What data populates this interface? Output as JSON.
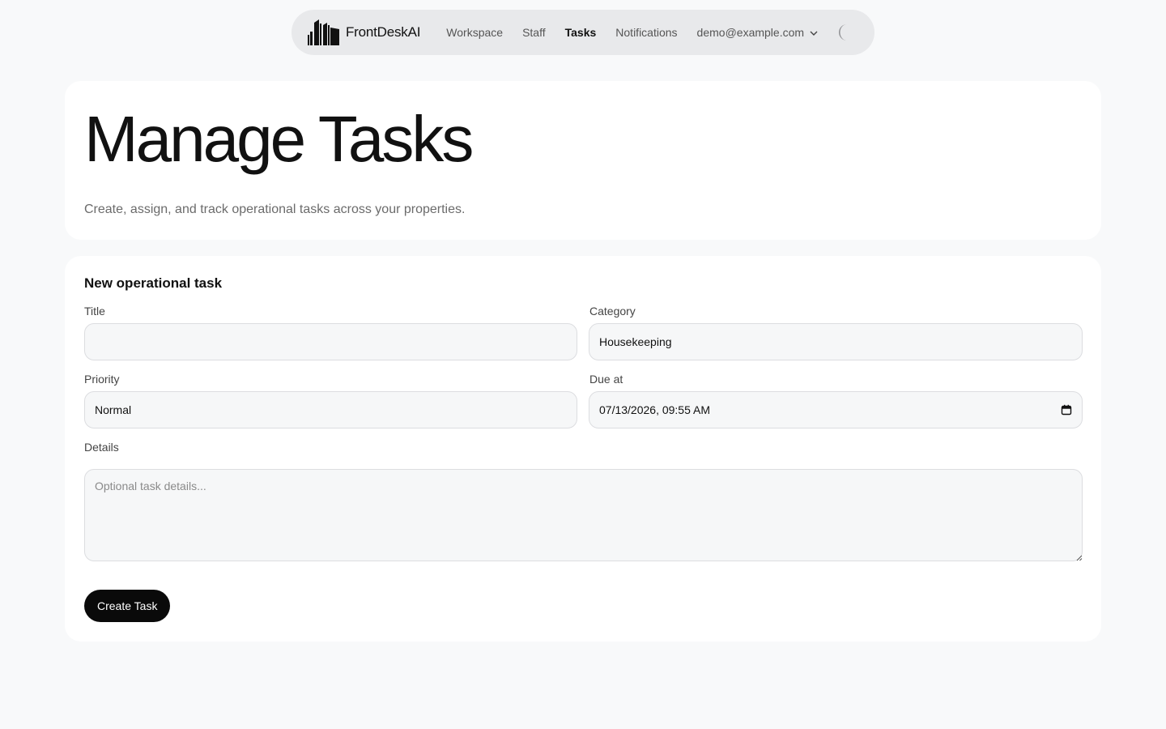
{
  "nav": {
    "brand_name": "FrontDeskAI",
    "brand_icon": "building-icon",
    "links": [
      {
        "label": "Workspace",
        "active": false
      },
      {
        "label": "Staff",
        "active": false
      },
      {
        "label": "Tasks",
        "active": true
      },
      {
        "label": "Notifications",
        "active": false
      }
    ],
    "user_email": "demo@example.com",
    "user_menu_icon": "chevron-down-icon",
    "theme_toggle_icon": "moon-icon"
  },
  "hero": {
    "title": "Manage Tasks",
    "subtitle": "Create, assign, and track operational tasks across your properties."
  },
  "form": {
    "heading": "New operational task",
    "title": {
      "label": "Title",
      "value": "",
      "placeholder": ""
    },
    "category": {
      "label": "Category",
      "value": "Housekeeping"
    },
    "priority": {
      "label": "Priority",
      "value": "Normal"
    },
    "due_at": {
      "label": "Due at",
      "value": "07/13/2026, 09:55 AM",
      "icon": "calendar-icon"
    },
    "details": {
      "label": "Details",
      "value": "",
      "placeholder": "Optional task details..."
    },
    "submit_label": "Create Task"
  },
  "colors": {
    "page_background": "#f8f9fa",
    "card_background": "#ffffff",
    "nav_background": "#e8e9eb",
    "primary_button": "#0a0a0a",
    "input_background": "#f6f7f8"
  }
}
